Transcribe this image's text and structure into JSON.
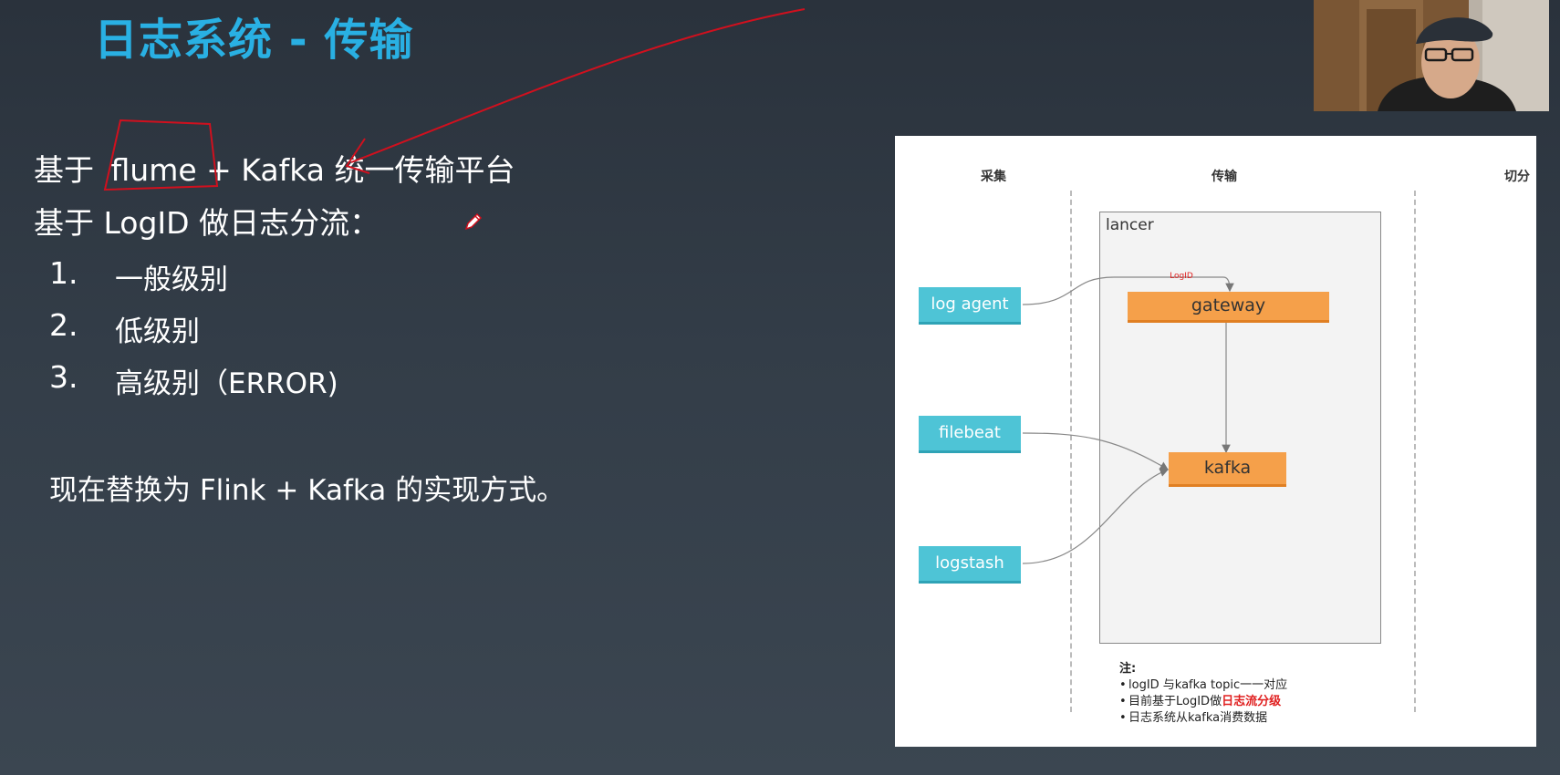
{
  "slide": {
    "title": "日志系统 - 传输",
    "line1_prefix": "基于",
    "line1_flume": "flume",
    "line1_rest": "+ Kafka 统一传输平台",
    "line2": "基于 LogID 做日志分流：",
    "items": [
      {
        "num": "1.",
        "text": "一般级别"
      },
      {
        "num": "2.",
        "text": "低级别"
      },
      {
        "num": "3.",
        "text": "高级别（ERROR)"
      }
    ],
    "footer": "现在替换为 Flink + Kafka 的实现方式。"
  },
  "diagram": {
    "columns": [
      "采集",
      "传输",
      "切分"
    ],
    "container_label": "lancer",
    "sources": [
      "log agent",
      "filebeat",
      "logstash"
    ],
    "edge_label": "LogID",
    "gateway": "gateway",
    "kafka": "kafka",
    "notes_title": "注:",
    "note1": "logID 与kafka topic一一对应",
    "note2_prefix": "目前基于LogID做",
    "note2_highlight": "日志流分级",
    "note3": "日志系统从kafka消费数据"
  },
  "colors": {
    "title": "#29b0e3",
    "annotation": "#d0101e",
    "source_box": "#4ec4d6",
    "process_box": "#f5a04a"
  },
  "icons": {
    "pen": "pen-cursor-icon"
  }
}
